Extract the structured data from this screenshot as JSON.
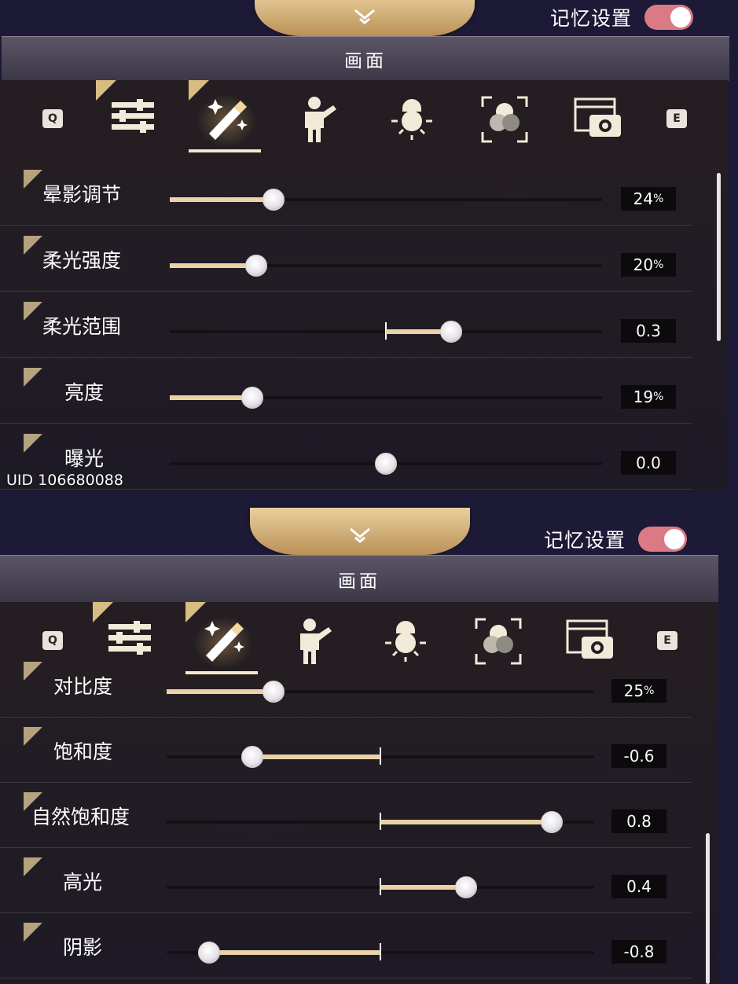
{
  "panels": [
    {
      "memory_label": "记忆设置",
      "title": "画面",
      "keys": {
        "left": "Q",
        "right": "E"
      },
      "tabs": [
        "sliders-icon",
        "magic-wand-icon",
        "person-icon",
        "lightbulb-icon",
        "color-circles-icon",
        "camera-icon"
      ],
      "active_tab": 1,
      "rows": [
        {
          "label": "晕影调节",
          "value": "24",
          "unit": "%",
          "kind": "percent",
          "level": 0.24
        },
        {
          "label": "柔光强度",
          "value": "20",
          "unit": "%",
          "kind": "percent",
          "level": 0.2
        },
        {
          "label": "柔光范围",
          "value": "0.3",
          "unit": "",
          "kind": "signed",
          "level": 0.3
        },
        {
          "label": "亮度",
          "value": "19",
          "unit": "%",
          "kind": "percent",
          "level": 0.19
        },
        {
          "label": "曝光",
          "value": "0.0",
          "unit": "",
          "kind": "signed",
          "level": 0.0
        }
      ],
      "uid": "UID 106680088"
    },
    {
      "memory_label": "记忆设置",
      "title": "画面",
      "keys": {
        "left": "Q",
        "right": "E"
      },
      "tabs": [
        "sliders-icon",
        "magic-wand-icon",
        "person-icon",
        "lightbulb-icon",
        "color-circles-icon",
        "camera-icon"
      ],
      "active_tab": 1,
      "rows": [
        {
          "label": "对比度",
          "value": "25",
          "unit": "%",
          "kind": "percent",
          "level": 0.25
        },
        {
          "label": "饱和度",
          "value": "-0.6",
          "unit": "",
          "kind": "signed",
          "level": -0.6
        },
        {
          "label": "自然饱和度",
          "value": "0.8",
          "unit": "",
          "kind": "signed",
          "level": 0.8
        },
        {
          "label": "高光",
          "value": "0.4",
          "unit": "",
          "kind": "signed",
          "level": 0.4
        },
        {
          "label": "阴影",
          "value": "-0.8",
          "unit": "",
          "kind": "signed",
          "level": -0.8
        }
      ]
    }
  ],
  "colors": {
    "accent_gold": "#e9d3a6",
    "toggle_on": "#d97a85"
  }
}
